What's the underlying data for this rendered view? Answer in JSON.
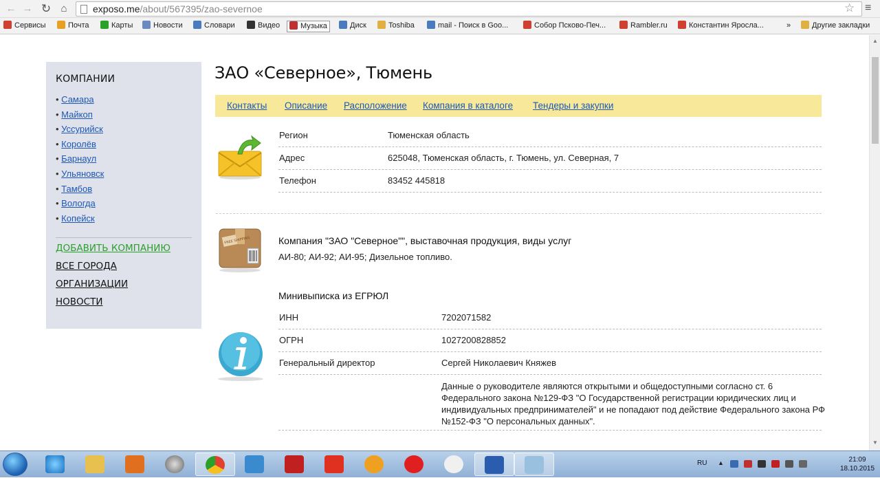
{
  "browser": {
    "url_host": "exposo.me",
    "url_path": "/about/567395/zao-severnoe",
    "bookmarks": [
      {
        "label": "Сервисы",
        "color": "#d04030"
      },
      {
        "label": "Почта",
        "color": "#e8a020"
      },
      {
        "label": "Карты",
        "color": "#2aa12a"
      },
      {
        "label": "Новости",
        "color": "#6a8ac0"
      },
      {
        "label": "Словари",
        "color": "#4a7ac0"
      },
      {
        "label": "Видео",
        "color": "#333333"
      },
      {
        "label": "Музыка",
        "color": "#c03030"
      },
      {
        "label": "Диск",
        "color": "#4a7ac0"
      },
      {
        "label": "Toshiba",
        "color": "#e0b040"
      },
      {
        "label": "mail - Поиск в Goo...",
        "color": "#4a7ac0"
      },
      {
        "label": "Собор Псково-Печ...",
        "color": "#d04030"
      },
      {
        "label": "Rambler.ru",
        "color": "#d04030"
      },
      {
        "label": "Константин Яросла...",
        "color": "#d04030"
      },
      {
        "label": "»",
        "color": ""
      },
      {
        "label": "Другие закладки",
        "color": "#e0b040"
      }
    ]
  },
  "sidebar": {
    "heading": "КОМПАНИИ",
    "cities": [
      "Самара",
      "Майкоп",
      "Уссурийск",
      "Королёв",
      "Барнаул",
      "Ульяновск",
      "Тамбов",
      "Вологда",
      "Копейск"
    ],
    "add_company": "ДОБАВИТЬ КОМПАНИЮ",
    "all_cities": "ВСЕ ГОРОДА",
    "organizations": "ОРГАНИЗАЦИИ",
    "news": "НОВОСТИ"
  },
  "page": {
    "title": "ЗАО «Северное», Тюмень",
    "tabs": [
      "Контакты",
      "Описание",
      "Расположение",
      "Компания в каталоге",
      "Тендеры и закупки"
    ],
    "contacts": [
      {
        "key": "Регион",
        "value": "Тюменская область"
      },
      {
        "key": "Адрес",
        "value": "625048, Тюменская область, г. Тюмень, ул. Северная, 7"
      },
      {
        "key": "Телефон",
        "value": "83452 445818"
      }
    ],
    "product_title": "Компания \"ЗАО \"Северное\"\", выставочная продукция, виды услуг",
    "product_desc": "АИ-80; АИ-92; АИ-95; Дизельное топливо.",
    "egrul_title": "Минивыписка из ЕГРЮЛ",
    "egrul": [
      {
        "key": "ИНН",
        "value": "7202071582"
      },
      {
        "key": "ОГРН",
        "value": "1027200828852"
      },
      {
        "key": "Генеральный директор",
        "value": "Сергей Николаевич Княжев"
      }
    ],
    "note": "Данные о руководителе являются открытыми и общедоступными согласно ст. 6 Федерального закона №129-ФЗ \"О Государственной регистрации юридических лиц и индивидуальных предпринимателей\" и не попадают под действие Федерального закона РФ №152-ФЗ \"О персональных данных\"."
  },
  "taskbar": {
    "lang": "RU",
    "time": "21:09",
    "date": "18.10.2015"
  }
}
